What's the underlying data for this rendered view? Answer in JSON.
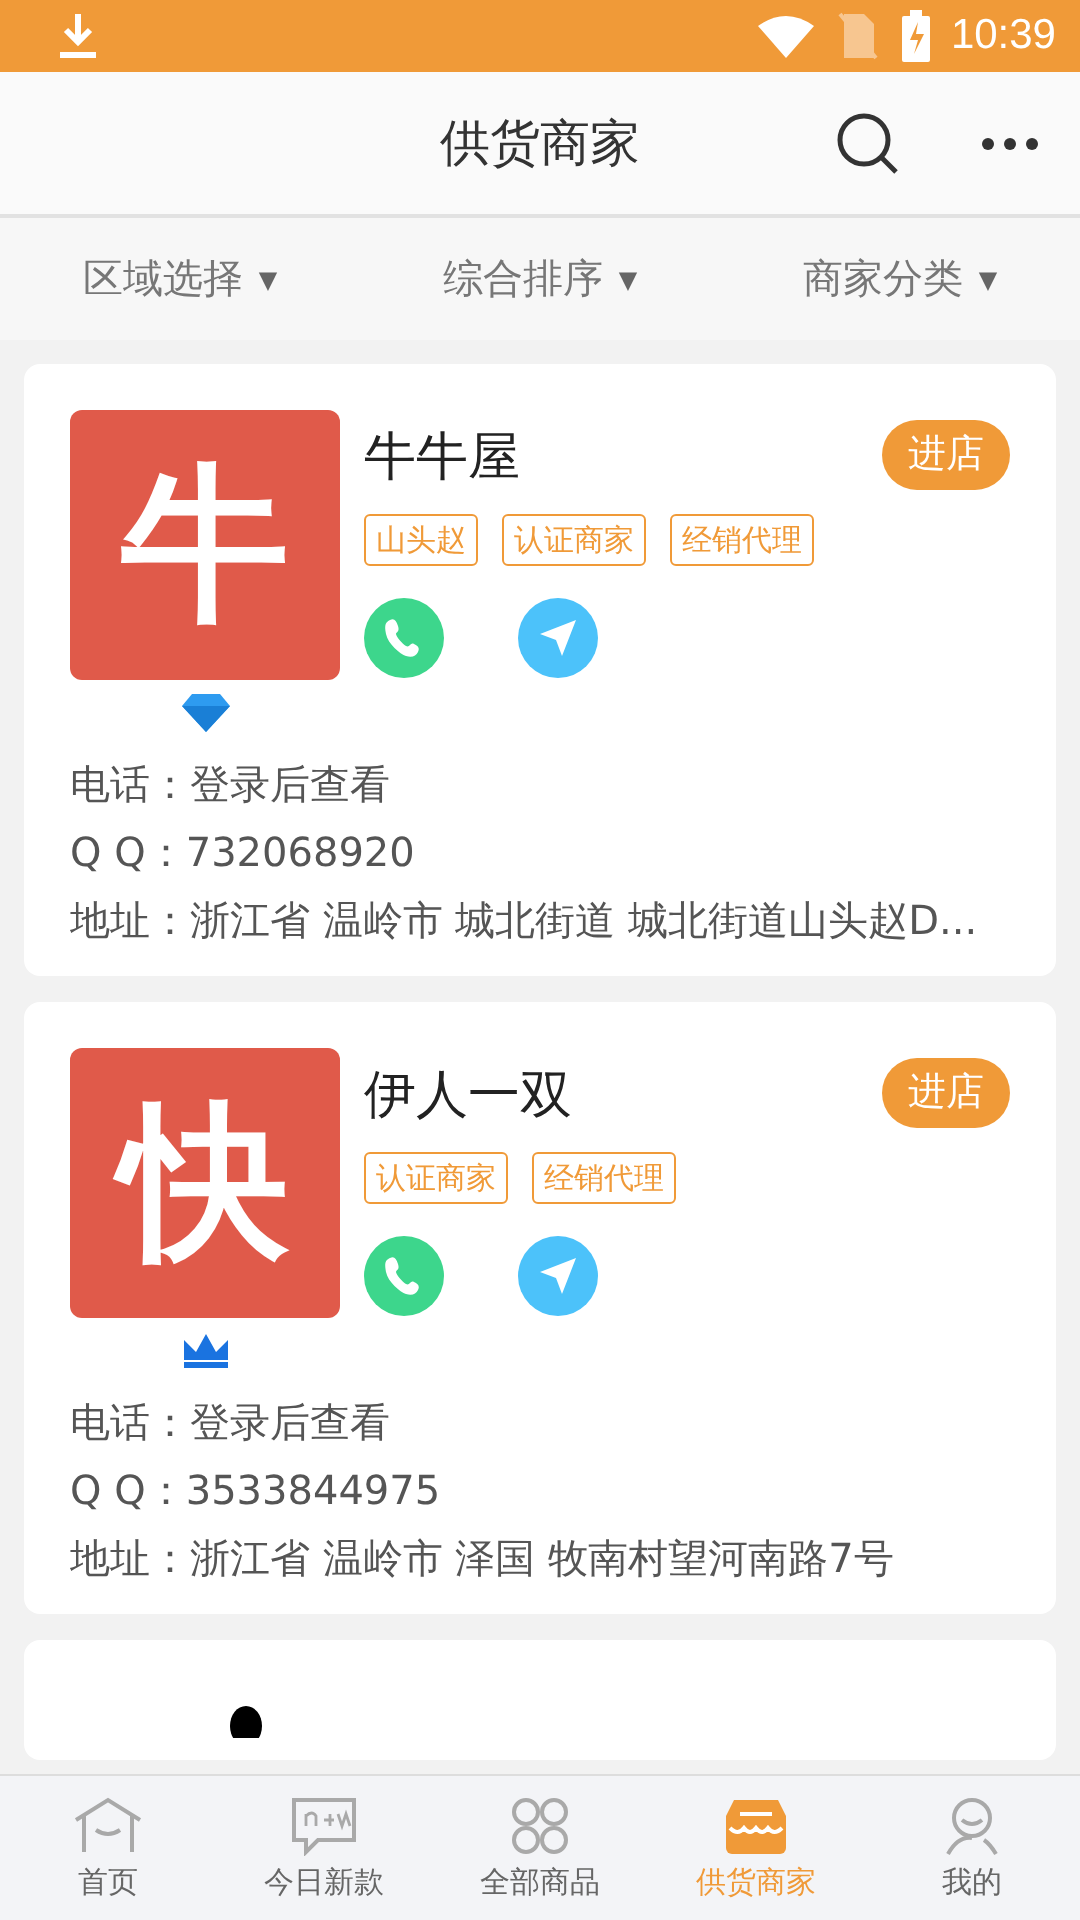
{
  "status_bar": {
    "time": "10:39"
  },
  "header": {
    "title": "供货商家"
  },
  "filters": [
    {
      "label": "区域选择",
      "arrow": "▼"
    },
    {
      "label": "综合排序",
      "arrow": "▼"
    },
    {
      "label": "商家分类",
      "arrow": "▼"
    }
  ],
  "merchants": [
    {
      "kind": "diamond",
      "logo_char": "牛",
      "name": "牛牛屋",
      "button": "进店",
      "tags": [
        "山头赵",
        "认证商家",
        "经销代理"
      ],
      "lines": [
        "电话：登录后查看",
        "Q Q：732068920",
        "地址：浙江省 温岭市 城北街道 城北街道山头赵D..."
      ]
    },
    {
      "kind": "crown",
      "logo_char": "快",
      "name": "伊人一双",
      "button": "进店",
      "tags": [
        "认证商家",
        "经销代理"
      ],
      "lines": [
        "电话：登录后查看",
        "Q Q：3533844975",
        "地址：浙江省 温岭市 泽国 牧南村望河南路7号"
      ]
    },
    {
      "kind": "partial"
    }
  ],
  "tab_bar": [
    {
      "label": "首页",
      "selected": false
    },
    {
      "label": "今日新款",
      "selected": false
    },
    {
      "label": "全部商品",
      "selected": false
    },
    {
      "label": "供货商家",
      "selected": true
    },
    {
      "label": "我的",
      "selected": false
    }
  ]
}
